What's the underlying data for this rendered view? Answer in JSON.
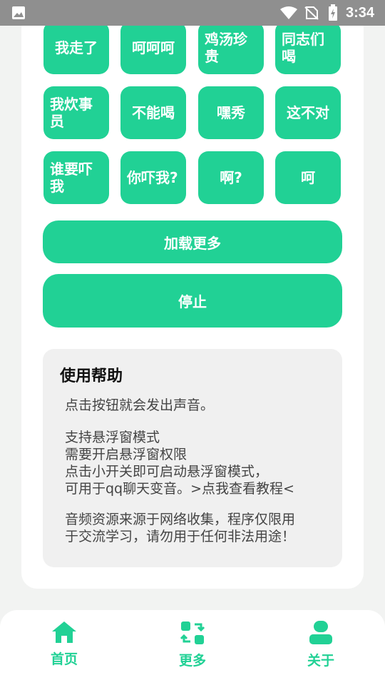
{
  "status_bar": {
    "time": "3:34"
  },
  "sound_buttons": [
    "我走了",
    "呵呵呵",
    "鸡汤珍贵",
    "同志们喝",
    "我炊事员",
    "不能喝",
    "嘿秀",
    "这不对",
    "谁要吓我",
    "你吓我?",
    "啊?",
    "呵"
  ],
  "actions": {
    "load_more": "加载更多",
    "stop": "停止"
  },
  "help": {
    "title": "使用帮助",
    "p1": "点击按钮就会发出声音。",
    "p2_line1": "支持悬浮窗模式",
    "p2_line2": "需要开启悬浮窗权限",
    "p2_line3": "点击小开关即可启动悬浮窗模式，",
    "p2_line4": "可用于qq聊天变音。>点我查看教程<",
    "p3_line1": "音频资源来源于网络收集，程序仅限用",
    "p3_line2": "于交流学习，请勿用于任何非法用途！"
  },
  "nav": {
    "home": "首页",
    "more": "更多",
    "about": "关于"
  },
  "colors": {
    "accent": "#21d195",
    "background": "#f2f3f2",
    "help_bg": "#f0f0f0"
  }
}
